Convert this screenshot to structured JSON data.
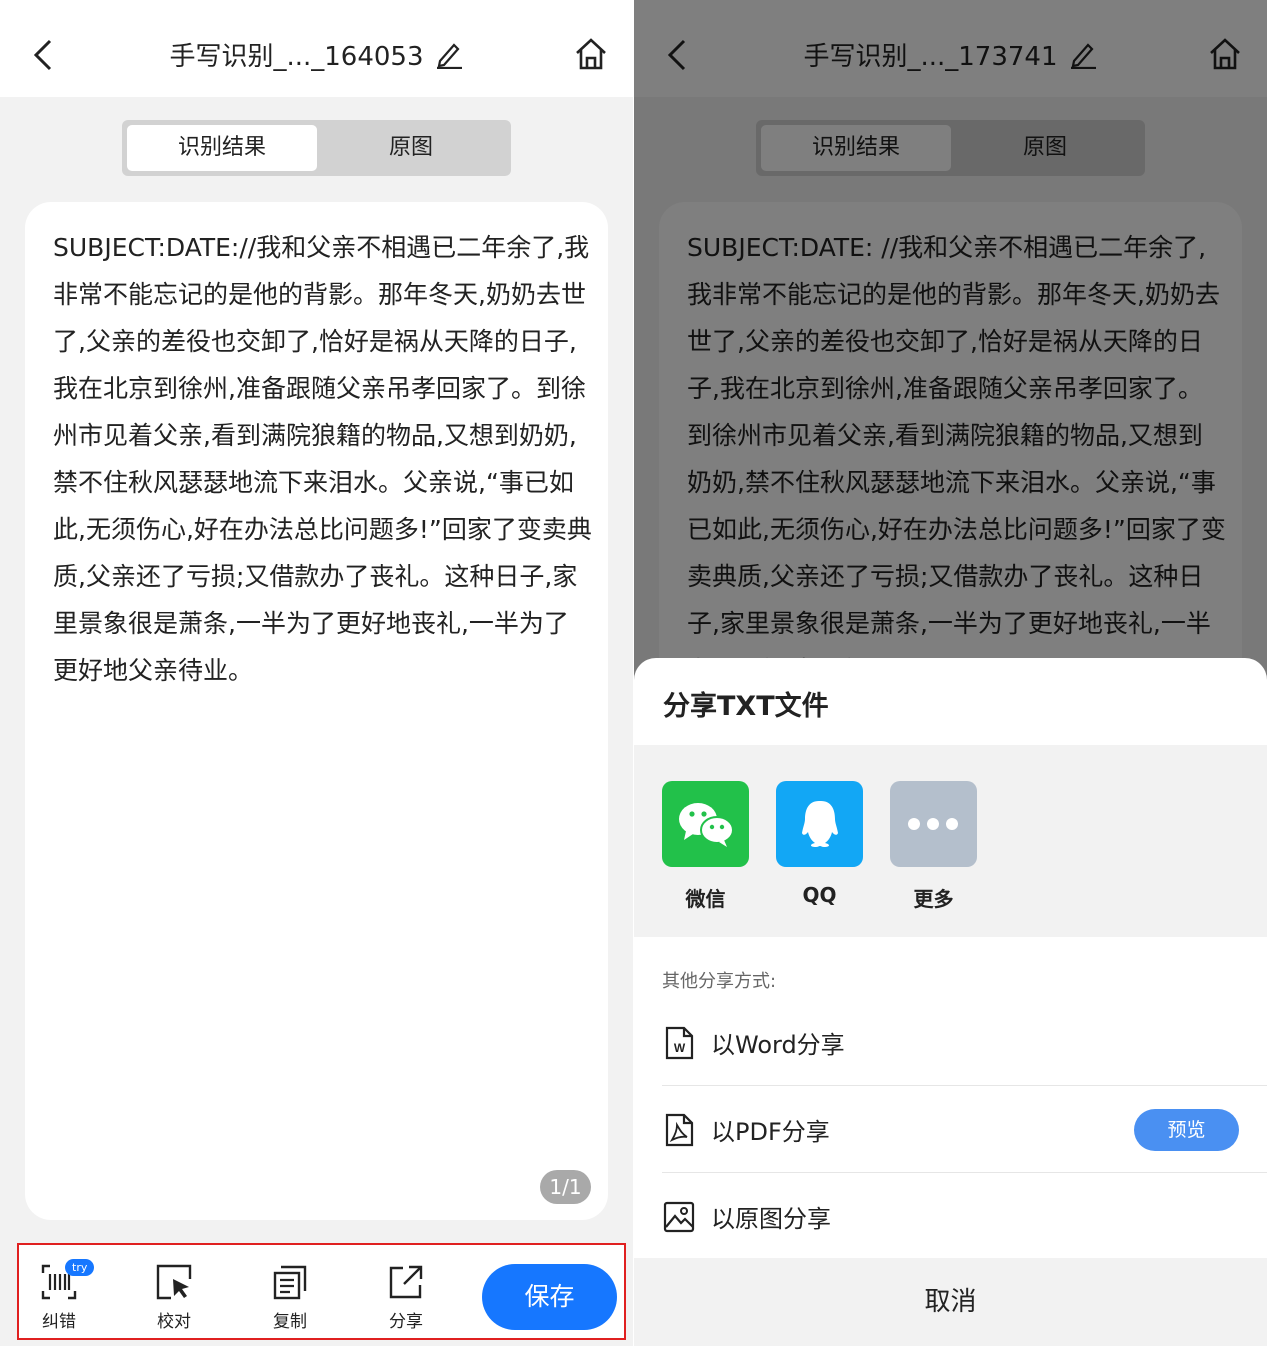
{
  "left": {
    "title": "手写识别_..._164053",
    "tabs": [
      "识别结果",
      "原图"
    ],
    "recognized_text": "SUBJECT:DATE://我和父亲不相遇已二年余了,我非常不能忘记的是他的背影。那年冬天,奶奶去世了,父亲的差役也交卸了,恰好是祸从天降的日子,我在北京到徐州,准备跟随父亲吊孝回家了。到徐州市见着父亲,看到满院狼籍的物品,又想到奶奶,禁不住秋风瑟瑟地流下来泪水。父亲说,“事已如此,无须伤心,好在办法总比问题多!”回家了变卖典质,父亲还了亏损;又借款办了丧礼。这种日子,家里景象很是萧条,一半为了更好地丧礼,一半为了更好地父亲待业。",
    "page_indicator": "1/1",
    "toolbar": {
      "correct_label": "纠错",
      "try_badge": "try",
      "proofread_label": "校对",
      "copy_label": "复制",
      "share_label": "分享",
      "save_label": "保存"
    }
  },
  "right": {
    "title": "手写识别_..._173741",
    "tabs": [
      "识别结果",
      "原图"
    ],
    "recognized_text": "SUBJECT:DATE: //我和父亲不相遇已二年余了,我非常不能忘记的是他的背影。那年冬天,奶奶去世了,父亲的差役也交卸了,恰好是祸从天降的日子,我在北京到徐州,准备跟随父亲吊孝回家了。到徐州市见着父亲,看到满院狼籍的物品,又想到奶奶,禁不住秋风瑟瑟地流下来泪水。父亲说,“事已如此,无须伤心,好在办法总比问题多!”回家了变卖典质,父亲还了亏损;又借款办了丧礼。这种日子,家里景象很是萧条,一半为了更好地丧礼,一半为了更好地父亲",
    "share_sheet": {
      "title": "分享TXT文件",
      "apps": [
        {
          "label": "微信",
          "icon": "wechat-icon",
          "color": "#22c14a"
        },
        {
          "label": "QQ",
          "icon": "qq-icon",
          "color": "#12a7f5"
        },
        {
          "label": "更多",
          "icon": "more-icon",
          "color": "#b4bfcc"
        }
      ],
      "other_title": "其他分享方式:",
      "options": [
        {
          "label": "以Word分享",
          "icon": "word-file-icon"
        },
        {
          "label": "以PDF分享",
          "icon": "pdf-file-icon",
          "action": "预览"
        },
        {
          "label": "以原图分享",
          "icon": "image-file-icon"
        }
      ],
      "cancel_label": "取消"
    }
  },
  "colors": {
    "accent": "#1677ff",
    "highlight_border": "#e02020",
    "wechat": "#22c14a",
    "qq": "#12a7f5"
  }
}
